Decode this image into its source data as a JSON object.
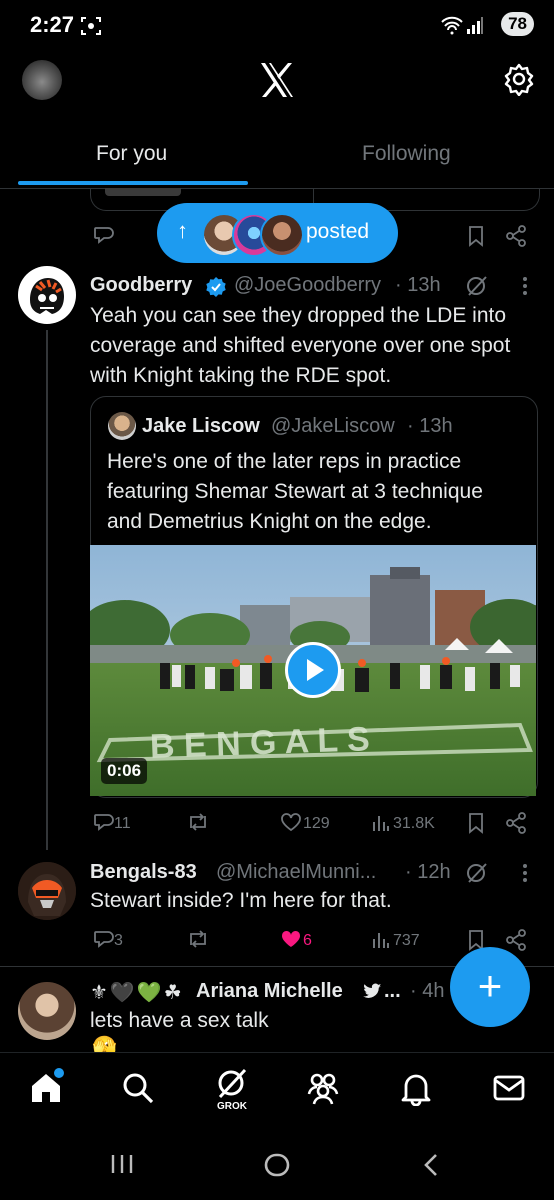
{
  "status_bar": {
    "time": "2:27",
    "battery": "78"
  },
  "tabs": {
    "for_you": "For you",
    "following": "Following"
  },
  "new_posts_pill": {
    "label": "posted"
  },
  "tweets": [
    {
      "name": "Goodberry",
      "verified": true,
      "handle": "@JoeGoodberry",
      "time": "· 13h",
      "text_lines": [
        "Yeah you can see they dropped the LDE into",
        "coverage and shifted everyone over one spot",
        "with Knight taking the RDE spot."
      ],
      "quote": {
        "name": "Jake Liscow",
        "handle": "@JakeLiscow",
        "time": "· 13h",
        "text_lines": [
          "Here's one of the later reps in practice",
          "featuring Shemar Stewart at 3 technique",
          "and Demetrius Knight on the edge."
        ],
        "video_duration": "0:06"
      },
      "actions": {
        "replies": "11",
        "reposts": "",
        "likes": "129",
        "views": "31.8K"
      }
    },
    {
      "name": "Bengals-83",
      "handle": "@MichaelMunni...",
      "time": "· 12h",
      "text_lines": [
        "Stewart inside? I'm here for that."
      ],
      "actions": {
        "replies": "3",
        "reposts": "",
        "likes": "6",
        "views": "737"
      }
    },
    {
      "name_emojis": "⚜🖤💚☘",
      "name": "Ariana Michelle",
      "handle": "...",
      "time": "· 4h",
      "text_lines": [
        "lets have a sex talk"
      ],
      "trailing_emoji": "🫣"
    }
  ],
  "bottom_nav": {
    "grok_label": "GROK"
  },
  "colors": {
    "accent": "#1d9bf0",
    "like": "#f91880",
    "muted": "#71767b"
  }
}
